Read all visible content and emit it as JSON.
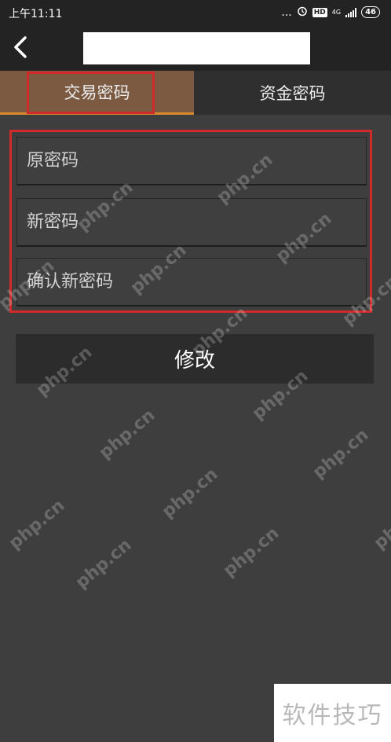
{
  "status_bar": {
    "time": "上午11:11",
    "dots": "...",
    "hd": "HD",
    "network": "4G",
    "battery": "46"
  },
  "tabs": [
    {
      "label": "交易密码"
    },
    {
      "label": "资金密码"
    }
  ],
  "form": {
    "old_password_placeholder": "原密码",
    "new_password_placeholder": "新密码",
    "confirm_password_placeholder": "确认新密码",
    "submit_label": "修改"
  },
  "watermark": {
    "text": "php.cn"
  },
  "corner_watermark": {
    "text": "软件技巧"
  },
  "colors": {
    "accent": "#d98b2b",
    "highlight_frame": "#d12a2a",
    "active_tab": "#7b5a41"
  }
}
